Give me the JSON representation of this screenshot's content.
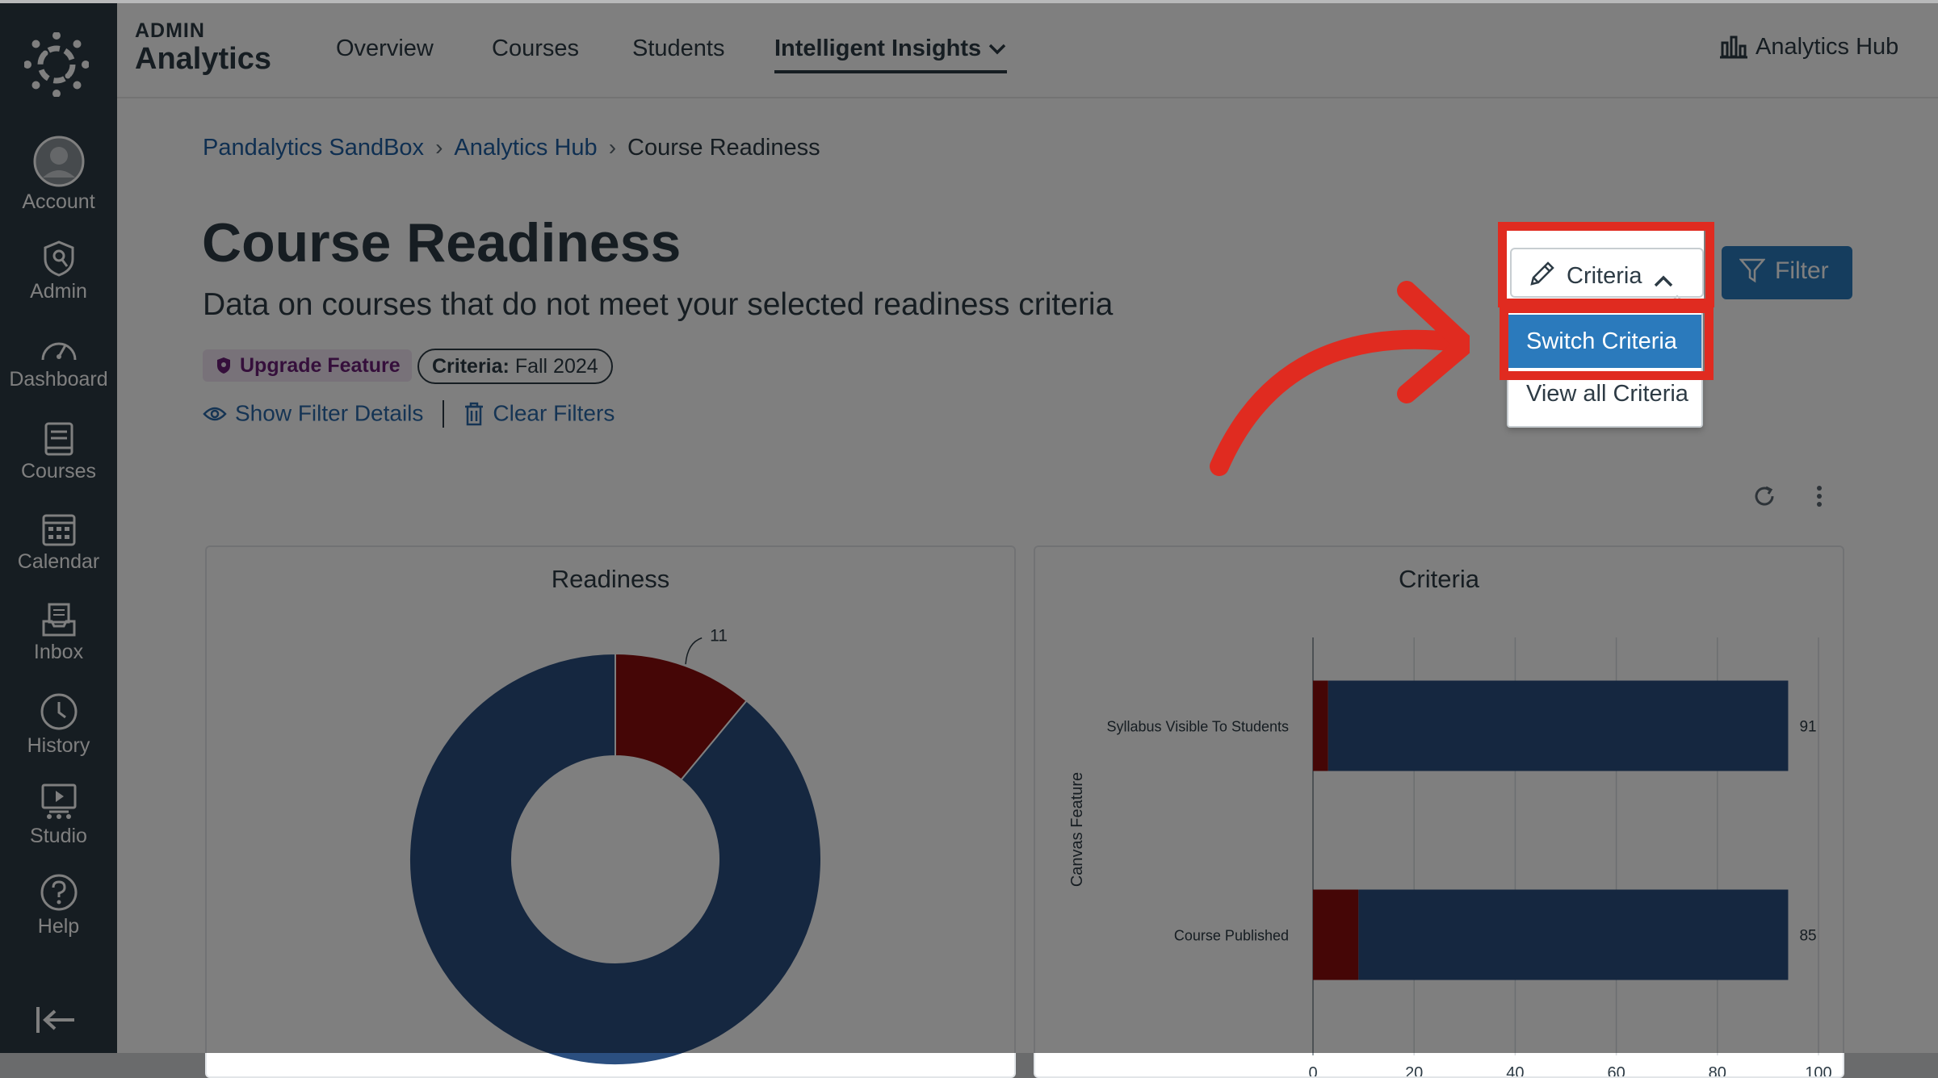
{
  "global_nav": {
    "items": [
      {
        "label": "Account",
        "icon": "account-icon"
      },
      {
        "label": "Admin",
        "icon": "admin-shield-icon"
      },
      {
        "label": "Dashboard",
        "icon": "dashboard-icon"
      },
      {
        "label": "Courses",
        "icon": "courses-book-icon"
      },
      {
        "label": "Calendar",
        "icon": "calendar-icon"
      },
      {
        "label": "Inbox",
        "icon": "inbox-icon"
      },
      {
        "label": "History",
        "icon": "history-clock-icon"
      },
      {
        "label": "Studio",
        "icon": "studio-icon"
      },
      {
        "label": "Help",
        "icon": "help-icon"
      }
    ]
  },
  "header": {
    "brand_small": "ADMIN",
    "brand_big": "Analytics",
    "tabs": [
      "Overview",
      "Courses",
      "Students",
      "Intelligent Insights"
    ],
    "analytics_hub": "Analytics Hub"
  },
  "breadcrumb": [
    "Pandalytics SandBox",
    "Analytics Hub",
    "Course Readiness"
  ],
  "page": {
    "title": "Course Readiness",
    "subtitle": "Data on courses that do not meet your selected readiness criteria",
    "upgrade_badge": "Upgrade Feature",
    "criteria_pill_label": "Criteria:",
    "criteria_pill_value": "Fall 2024",
    "show_filter_details": "Show Filter Details",
    "clear_filters": "Clear Filters"
  },
  "actions": {
    "criteria_button": "Criteria",
    "filter_button": "Filter",
    "menu_items": [
      "Switch Criteria",
      "View all Criteria"
    ]
  },
  "colors": {
    "brand_dark": "#2d3b45",
    "series_blue": "#2b4f80",
    "series_red": "#8b0d0d",
    "highlight": "#e02b20",
    "primary_button": "#2b7abc"
  },
  "chart_data": [
    {
      "type": "pie",
      "title": "Readiness",
      "slices": [
        {
          "value": 11,
          "color": "#8b0d0d",
          "label": "11"
        },
        {
          "value": 89,
          "color": "#2b4f80"
        }
      ]
    },
    {
      "type": "bar",
      "orientation": "horizontal",
      "stacked": true,
      "title": "Criteria",
      "ylabel": "Canvas Feature",
      "categories": [
        "Syllabus Visible To Students",
        "Course Published"
      ],
      "series": [
        {
          "values": [
            3,
            9
          ],
          "color": "#8b0d0d"
        },
        {
          "values": [
            91,
            85
          ],
          "color": "#2b4f80"
        }
      ],
      "xlim": [
        0,
        100
      ],
      "xticks": [
        0,
        20,
        40,
        60,
        80,
        100
      ],
      "grid": true
    }
  ]
}
